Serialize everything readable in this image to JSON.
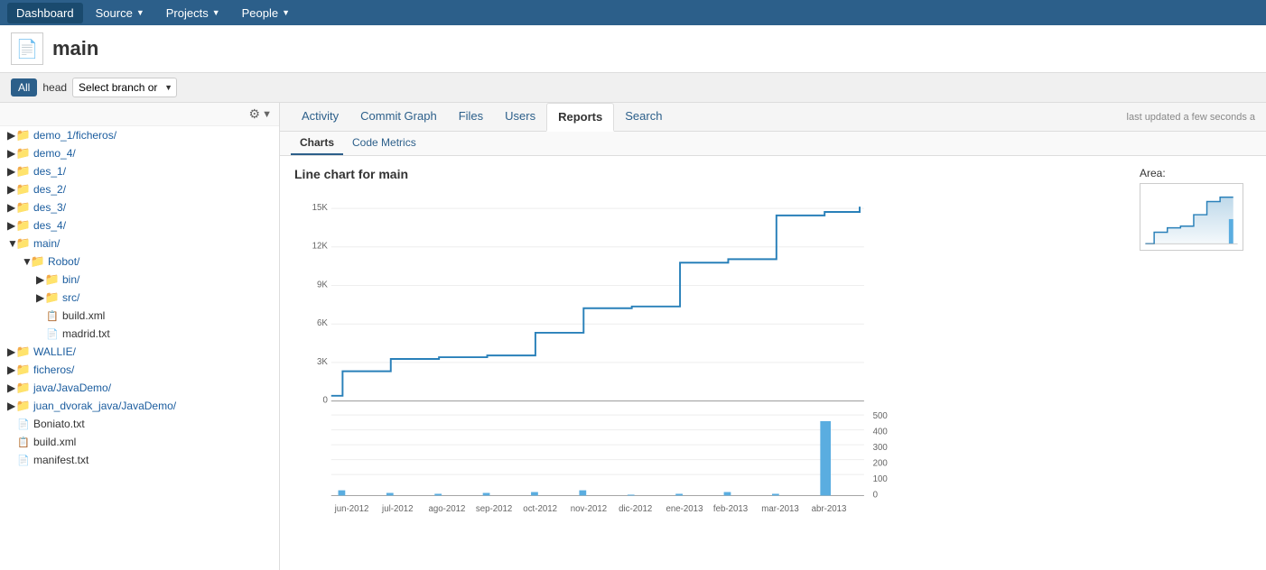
{
  "nav": {
    "items": [
      {
        "id": "dashboard",
        "label": "Dashboard",
        "active": true,
        "hasArrow": false
      },
      {
        "id": "source",
        "label": "Source",
        "active": false,
        "hasArrow": true
      },
      {
        "id": "projects",
        "label": "Projects",
        "active": false,
        "hasArrow": true
      },
      {
        "id": "people",
        "label": "People",
        "active": false,
        "hasArrow": true
      }
    ]
  },
  "repo": {
    "title": "main"
  },
  "branch": {
    "all_label": "All",
    "head_label": "head",
    "select_placeholder": "Select branch or",
    "dropdown_arrow": "▼"
  },
  "sidebar": {
    "items": [
      {
        "id": "demo1",
        "label": "demo_1/ficheros/",
        "level": 0,
        "type": "folder",
        "expanded": false,
        "hasArrow": true
      },
      {
        "id": "demo4",
        "label": "demo_4/",
        "level": 0,
        "type": "folder",
        "expanded": false,
        "hasArrow": true
      },
      {
        "id": "des1",
        "label": "des_1/",
        "level": 0,
        "type": "folder",
        "expanded": false,
        "hasArrow": true
      },
      {
        "id": "des2",
        "label": "des_2/",
        "level": 0,
        "type": "folder",
        "expanded": false,
        "hasArrow": true
      },
      {
        "id": "des3",
        "label": "des_3/",
        "level": 0,
        "type": "folder",
        "expanded": false,
        "hasArrow": true
      },
      {
        "id": "des4",
        "label": "des_4/",
        "level": 0,
        "type": "folder",
        "expanded": false,
        "hasArrow": true
      },
      {
        "id": "main",
        "label": "main/",
        "level": 0,
        "type": "folder",
        "expanded": true,
        "hasArrow": true
      },
      {
        "id": "robot",
        "label": "Robot/",
        "level": 1,
        "type": "folder",
        "expanded": true,
        "hasArrow": true
      },
      {
        "id": "bin",
        "label": "bin/",
        "level": 2,
        "type": "folder",
        "expanded": false,
        "hasArrow": true
      },
      {
        "id": "src",
        "label": "src/",
        "level": 2,
        "type": "folder",
        "expanded": false,
        "hasArrow": true
      },
      {
        "id": "buildxml",
        "label": "build.xml",
        "level": 2,
        "type": "file-xml",
        "expanded": false,
        "hasArrow": false
      },
      {
        "id": "madridtxt",
        "label": "madrid.txt",
        "level": 2,
        "type": "file-txt",
        "expanded": false,
        "hasArrow": false
      },
      {
        "id": "wallie",
        "label": "WALLIE/",
        "level": 0,
        "type": "folder",
        "expanded": false,
        "hasArrow": true
      },
      {
        "id": "ficheros",
        "label": "ficheros/",
        "level": 0,
        "type": "folder",
        "expanded": false,
        "hasArrow": true
      },
      {
        "id": "java",
        "label": "java/JavaDemo/",
        "level": 0,
        "type": "folder",
        "expanded": false,
        "hasArrow": true
      },
      {
        "id": "juandvorak",
        "label": "juan_dvorak_java/JavaDemo/",
        "level": 0,
        "type": "folder",
        "expanded": false,
        "hasArrow": true
      },
      {
        "id": "boniato",
        "label": "Boniato.txt",
        "level": 0,
        "type": "file-txt",
        "expanded": false,
        "hasArrow": false
      },
      {
        "id": "buildxml2",
        "label": "build.xml",
        "level": 0,
        "type": "file-xml",
        "expanded": false,
        "hasArrow": false
      },
      {
        "id": "manifest",
        "label": "manifest.txt",
        "level": 0,
        "type": "file-txt",
        "expanded": false,
        "hasArrow": false
      }
    ]
  },
  "tabs": [
    {
      "id": "activity",
      "label": "Activity",
      "active": false
    },
    {
      "id": "commit-graph",
      "label": "Commit Graph",
      "active": false
    },
    {
      "id": "files",
      "label": "Files",
      "active": false
    },
    {
      "id": "users",
      "label": "Users",
      "active": false
    },
    {
      "id": "reports",
      "label": "Reports",
      "active": true
    },
    {
      "id": "search",
      "label": "Search",
      "active": false
    }
  ],
  "last_updated": "last updated a few seconds a",
  "sub_tabs": [
    {
      "id": "charts",
      "label": "Charts",
      "active": true
    },
    {
      "id": "code-metrics",
      "label": "Code Metrics",
      "active": false
    }
  ],
  "chart": {
    "title": "Line chart for main",
    "area_label": "Area:",
    "y_labels": [
      "15K",
      "12K",
      "9K",
      "6K",
      "3K",
      "0"
    ],
    "y2_labels": [
      "500",
      "400",
      "300",
      "200",
      "100",
      "0"
    ],
    "x_labels": [
      "jun-2012",
      "jul-2012",
      "ago-2012",
      "sep-2012",
      "oct-2012",
      "nov-2012",
      "dic-2012",
      "ene-2013",
      "feb-2013",
      "mar-2013",
      "abr-2013"
    ]
  }
}
